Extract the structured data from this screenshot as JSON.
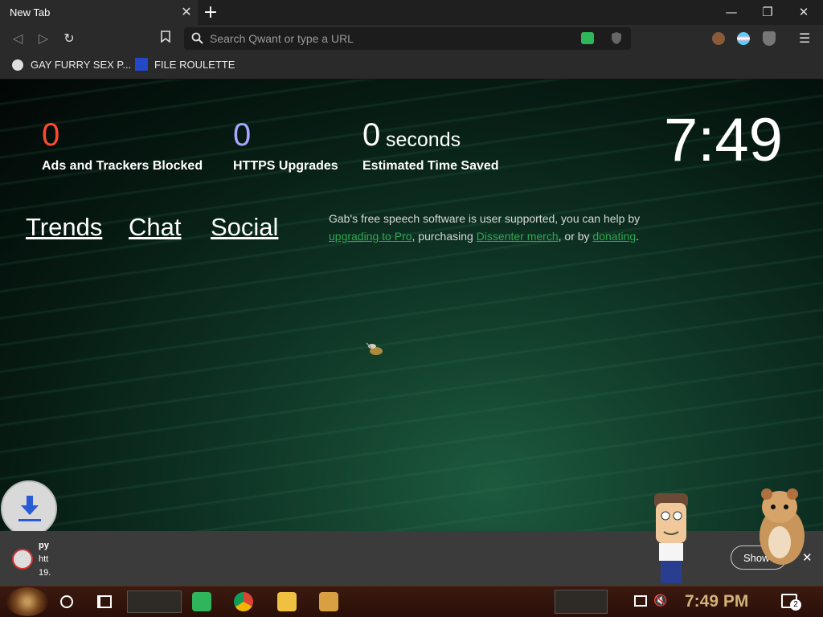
{
  "browser": {
    "tab_title": "New Tab",
    "tab_close": "✕",
    "new_tab": "+",
    "window_controls": {
      "minimize": "—",
      "restore": "❐",
      "close": "✕"
    },
    "url_placeholder": "Search Qwant or type a URL",
    "bookmarks": [
      {
        "label": "GAY FURRY SEX P...",
        "icon": "globe-icon"
      },
      {
        "label": "FILE ROULETTE",
        "icon": "mf-icon"
      }
    ]
  },
  "stats": {
    "ads": {
      "value": "0",
      "label": "Ads and Trackers Blocked",
      "color": "#ff4a2e"
    },
    "https": {
      "value": "0",
      "label": "HTTPS Upgrades",
      "color": "#a9a7ff"
    },
    "time": {
      "value": "0",
      "unit": "seconds",
      "label": "Estimated Time Saved",
      "color": "#ffffff"
    }
  },
  "clock": "7:49",
  "nav_links": [
    "Trends",
    "Chat",
    "Social"
  ],
  "gab_message": {
    "text1": "Gab's free speech software is user supported, you can help by ",
    "link1": "upgrading to Pro",
    "text2": ", purchasing ",
    "link2": "Dissenter merch",
    "text3": ", or by ",
    "link3": "donating",
    "text4": "."
  },
  "download_bar": {
    "item_line1": "py",
    "item_line2": "htt",
    "item_line3": "19.",
    "show_all": "Show",
    "close": "✕"
  },
  "taskbar": {
    "time": "7:49 PM",
    "notification_count": "2"
  },
  "colors": {
    "accent_green": "#2fa84f",
    "taskbar_bg": "#2a0f08"
  }
}
